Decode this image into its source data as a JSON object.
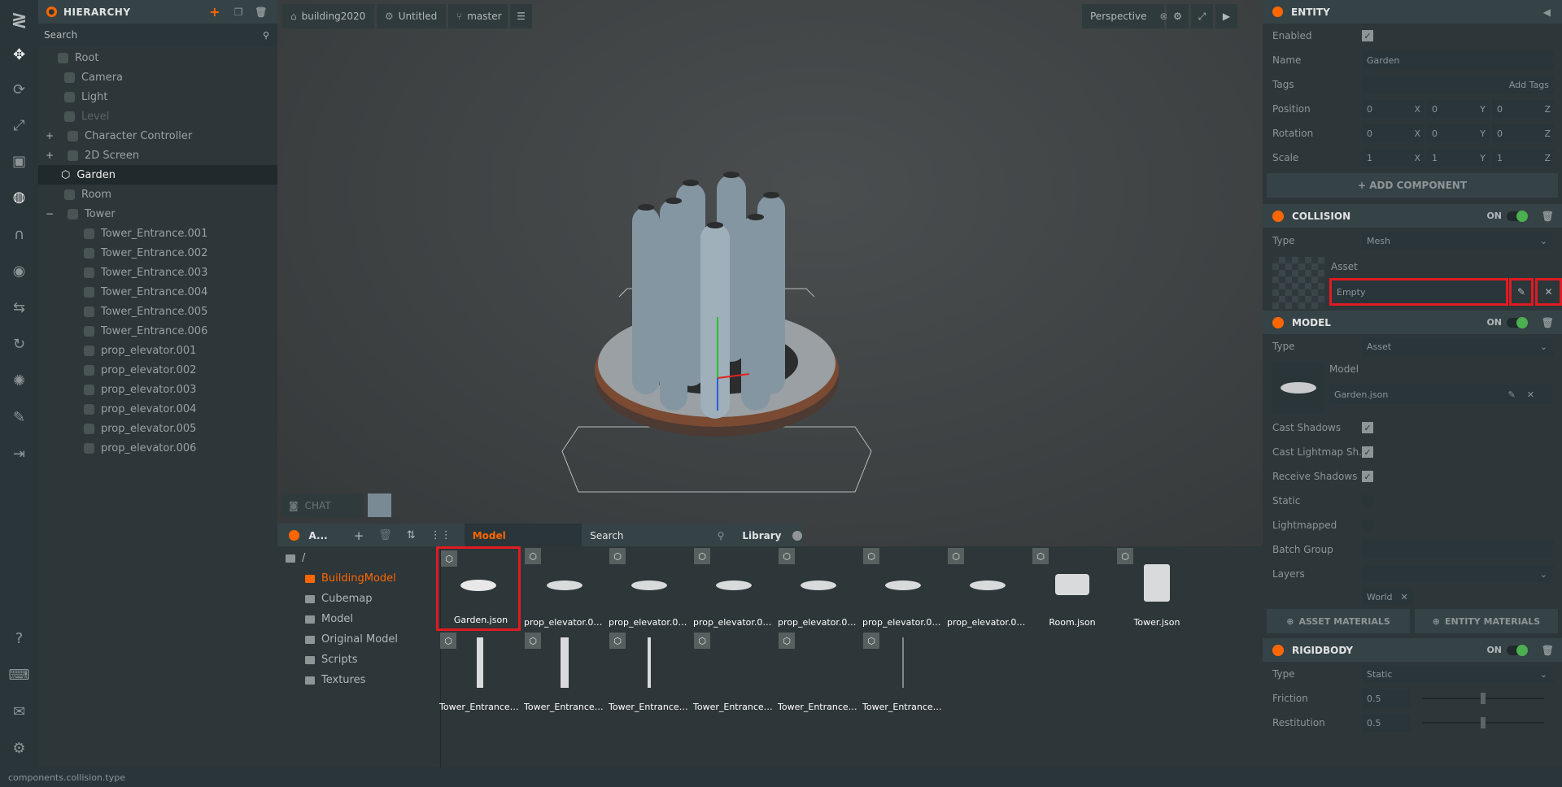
{
  "toolbar": {
    "icons": [
      "logo-icon",
      "move-icon",
      "rotate-icon",
      "scale-icon",
      "resize-icon",
      "world-icon",
      "magnet-icon",
      "eye-icon",
      "bake-icon",
      "history-icon",
      "light-icon",
      "edit-icon",
      "export-icon",
      "help-icon",
      "keyboard-icon",
      "chat-icon",
      "settings-icon"
    ]
  },
  "hierarchy": {
    "title": "HIERARCHY",
    "search_placeholder": "Search",
    "items": [
      {
        "label": "Root",
        "indent": 0
      },
      {
        "label": "Camera",
        "indent": 1
      },
      {
        "label": "Light",
        "indent": 1
      },
      {
        "label": "Level",
        "indent": 1
      },
      {
        "label": "Character Controller",
        "indent": 1
      },
      {
        "label": "2D Screen",
        "indent": 1
      },
      {
        "label": "Garden",
        "indent": 1
      },
      {
        "label": "Room",
        "indent": 1
      },
      {
        "label": "Tower",
        "indent": 1
      },
      {
        "label": "Tower_Entrance.001",
        "indent": 2
      },
      {
        "label": "Tower_Entrance.002",
        "indent": 2
      },
      {
        "label": "Tower_Entrance.003",
        "indent": 2
      },
      {
        "label": "Tower_Entrance.004",
        "indent": 2
      },
      {
        "label": "Tower_Entrance.005",
        "indent": 2
      },
      {
        "label": "Tower_Entrance.006",
        "indent": 2
      },
      {
        "label": "prop_elevator.001",
        "indent": 2
      },
      {
        "label": "prop_elevator.002",
        "indent": 2
      },
      {
        "label": "prop_elevator.003",
        "indent": 2
      },
      {
        "label": "prop_elevator.004",
        "indent": 2
      },
      {
        "label": "prop_elevator.005",
        "indent": 2
      },
      {
        "label": "prop_elevator.006",
        "indent": 2
      }
    ]
  },
  "viewport": {
    "project": "building2020",
    "scene": "Untitled",
    "branch": "master",
    "camera": "Perspective",
    "chat": "CHAT"
  },
  "assets": {
    "title": "A...",
    "filter": "Model",
    "search": "Search",
    "library": "Library",
    "root": "/",
    "folders": [
      "BuildingModel",
      "Cubemap",
      "Model",
      "Original Model",
      "Scripts",
      "Textures"
    ],
    "row1": [
      "Garden.json",
      "prop_elevator.00...",
      "prop_elevator.00...",
      "prop_elevator.00...",
      "prop_elevator.00...",
      "prop_elevator.00...",
      "prop_elevator.00...",
      "Room.json",
      "Tower.json"
    ],
    "row2": [
      "Tower_Entrance....",
      "Tower_Entrance....",
      "Tower_Entrance....",
      "Tower_Entrance....",
      "Tower_Entrance....",
      "Tower_Entrance...."
    ]
  },
  "inspector": {
    "title": "ENTITY",
    "enabled_label": "Enabled",
    "name_label": "Name",
    "name_value": "Garden",
    "tags_label": "Tags",
    "add_tags": "Add Tags",
    "position_label": "Position",
    "rotation_label": "Rotation",
    "scale_label": "Scale",
    "position": [
      "0",
      "0",
      "0"
    ],
    "rotation": [
      "0",
      "0",
      "0"
    ],
    "scale": [
      "1",
      "1",
      "1"
    ],
    "axis": [
      "X",
      "Y",
      "Z"
    ],
    "add_component": "+ ADD COMPONENT",
    "collision": {
      "title": "COLLISION",
      "on": "ON",
      "type_label": "Type",
      "type_value": "Mesh",
      "asset_label": "Asset",
      "asset_value": "Empty"
    },
    "model": {
      "title": "MODEL",
      "on": "ON",
      "type_label": "Type",
      "type_value": "Asset",
      "model_label": "Model",
      "model_value": "Garden.json",
      "cast_shadows": "Cast Shadows",
      "cast_lightmap": "Cast Lightmap Sh...",
      "receive_shadows": "Receive Shadows",
      "static": "Static",
      "lightmapped": "Lightmapped",
      "batch_group": "Batch Group",
      "layers": "Layers",
      "layer_value": "World",
      "asset_materials": "ASSET MATERIALS",
      "entity_materials": "ENTITY MATERIALS"
    },
    "rigidbody": {
      "title": "RIGIDBODY",
      "on": "ON",
      "type_label": "Type",
      "type_value": "Static",
      "friction_label": "Friction",
      "friction_value": "0.5",
      "restitution_label": "Restitution",
      "restitution_value": "0.5"
    }
  },
  "status": {
    "text": "components.collision.type"
  }
}
